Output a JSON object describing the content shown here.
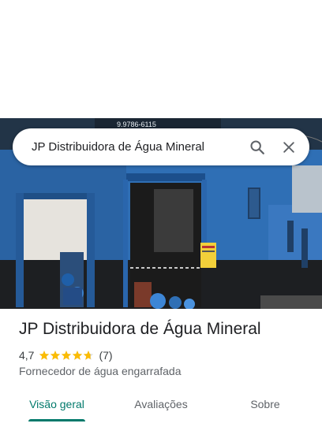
{
  "search": {
    "query": "JP Distribuidora de Água Mineral",
    "search_icon": "search-icon",
    "close_icon": "close-icon"
  },
  "hero": {
    "sign_phone": "9.9786-6115"
  },
  "place": {
    "title": "JP Distribuidora de Água Mineral",
    "rating": "4,7",
    "stars": 4.7,
    "review_count": "(7)",
    "category": "Fornecedor de água engarrafada"
  },
  "tabs": [
    {
      "label": "Visão geral",
      "active": true
    },
    {
      "label": "Avaliações",
      "active": false
    },
    {
      "label": "Sobre",
      "active": false
    }
  ],
  "colors": {
    "accent": "#00796b",
    "star": "#fbbc04",
    "wall_blue": "#2f6fb5"
  }
}
